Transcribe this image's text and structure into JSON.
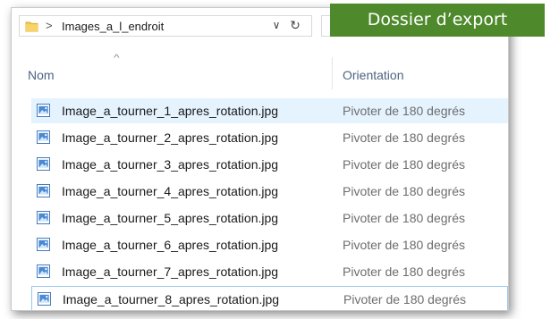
{
  "address_bar": {
    "separator": ">",
    "path": "Images_a_l_endroit",
    "dropdown_icon": "chevron-down-icon",
    "refresh_icon": "refresh-icon",
    "refresh_glyph": "↻",
    "dropdown_glyph": "∨"
  },
  "banner": {
    "text": "Dossier d’export",
    "color": "#4e8a2c"
  },
  "columns": {
    "name": "Nom",
    "orientation": "Orientation",
    "sort_indicator": "^"
  },
  "files": [
    {
      "name": "Image_a_tourner_1_apres_rotation.jpg",
      "orientation": "Pivoter de 180 degrés"
    },
    {
      "name": "Image_a_tourner_2_apres_rotation.jpg",
      "orientation": "Pivoter de 180 degrés"
    },
    {
      "name": "Image_a_tourner_3_apres_rotation.jpg",
      "orientation": "Pivoter de 180 degrés"
    },
    {
      "name": "Image_a_tourner_4_apres_rotation.jpg",
      "orientation": "Pivoter de 180 degrés"
    },
    {
      "name": "Image_a_tourner_5_apres_rotation.jpg",
      "orientation": "Pivoter de 180 degrés"
    },
    {
      "name": "Image_a_tourner_6_apres_rotation.jpg",
      "orientation": "Pivoter de 180 degrés"
    },
    {
      "name": "Image_a_tourner_7_apres_rotation.jpg",
      "orientation": "Pivoter de 180 degrés"
    },
    {
      "name": "Image_a_tourner_8_apres_rotation.jpg",
      "orientation": "Pivoter de 180 degrés"
    }
  ],
  "colors": {
    "selection": "#e5f3ff",
    "focus_border": "#99c9ef",
    "header_text": "#4d6480"
  }
}
